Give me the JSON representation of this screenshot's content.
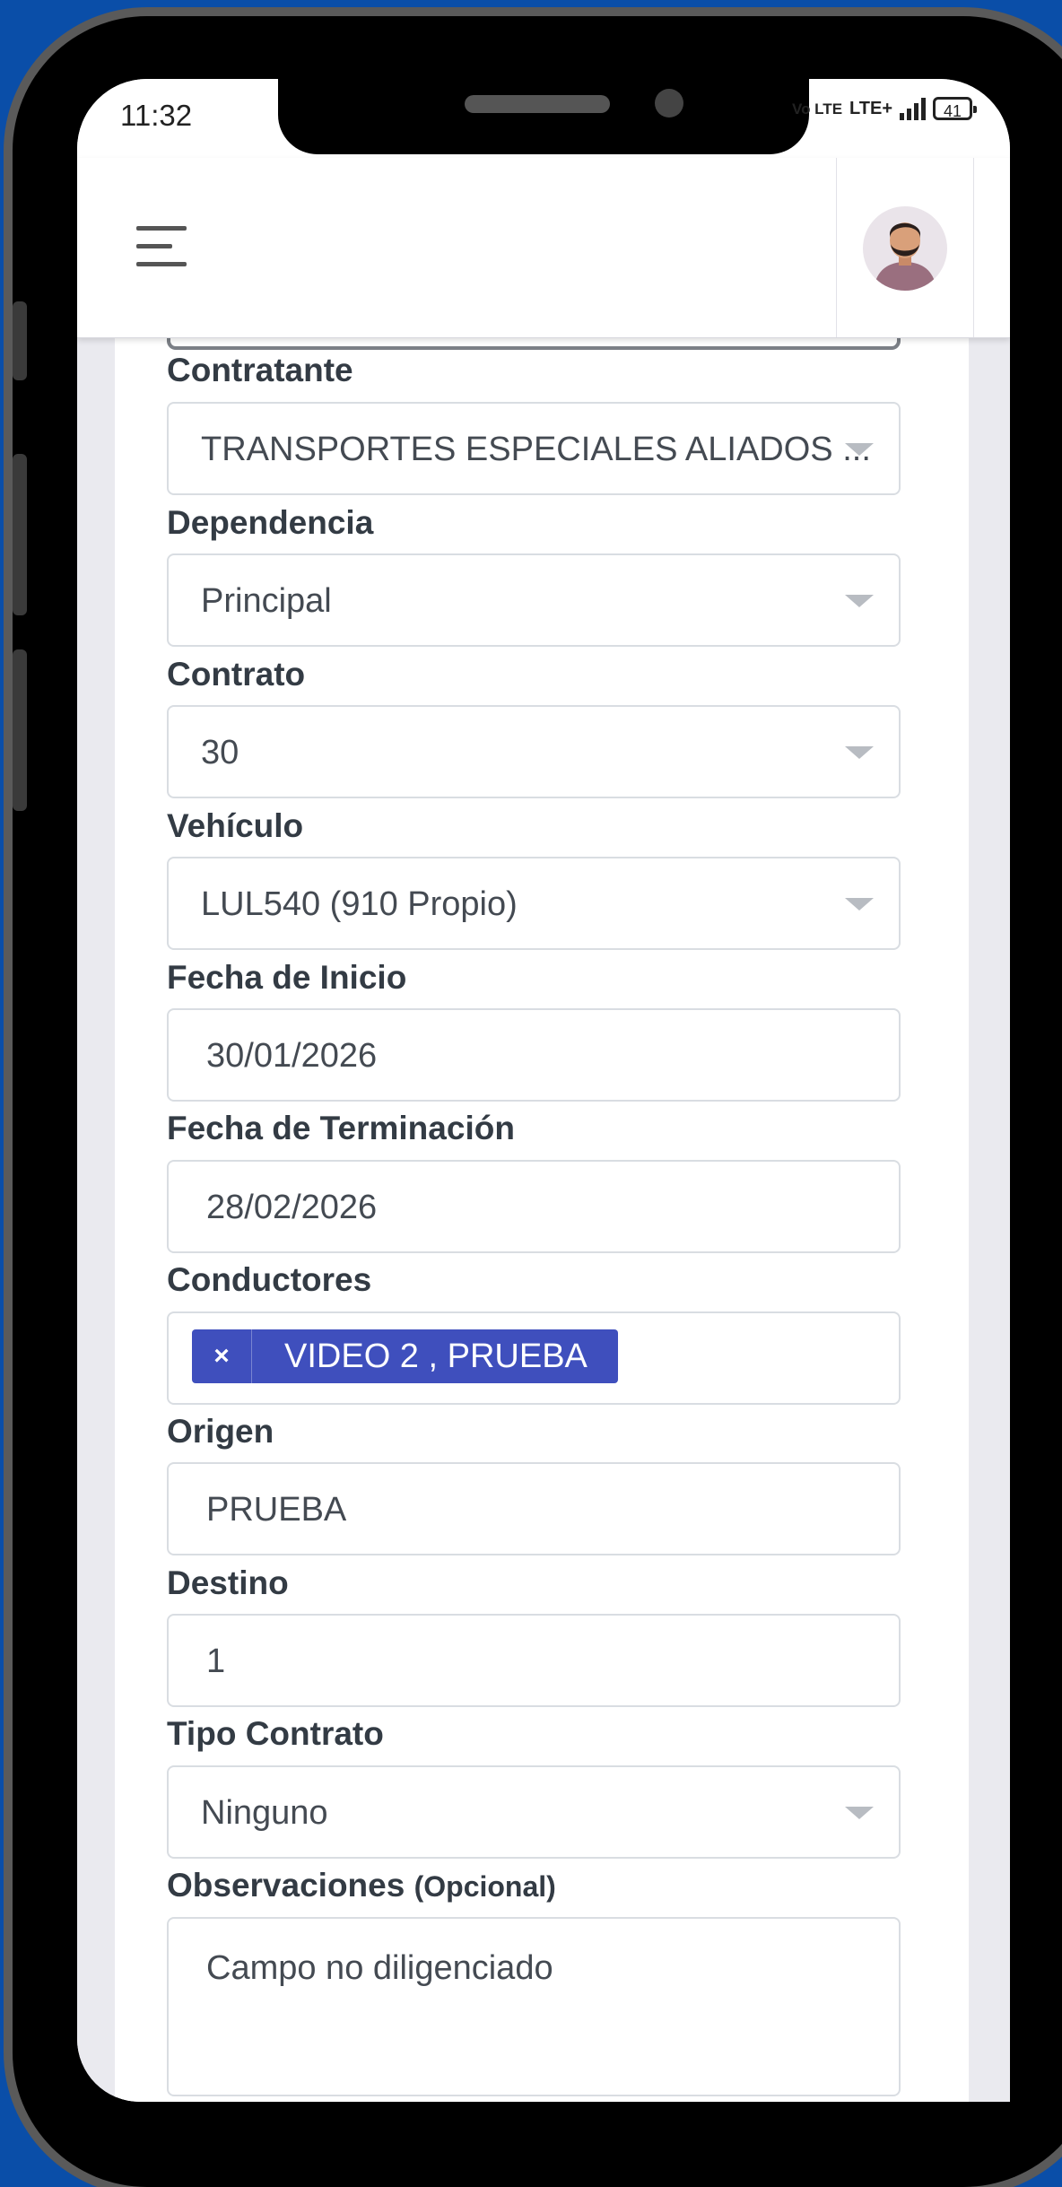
{
  "status_bar": {
    "time": "11:32",
    "network": "Vo LTE",
    "lte": "LTE+",
    "battery": "41"
  },
  "header": {
    "menu_icon": "hamburger-menu-icon",
    "avatar_icon": "user-avatar-icon"
  },
  "form": {
    "contratante": {
      "label": "Contratante",
      "value": "TRANSPORTES ESPECIALES ALIADOS ..."
    },
    "dependencia": {
      "label": "Dependencia",
      "value": "Principal"
    },
    "contrato": {
      "label": "Contrato",
      "value": "30"
    },
    "vehiculo": {
      "label": "Vehículo",
      "value": "LUL540 (910 Propio)"
    },
    "fecha_inicio": {
      "label": "Fecha de Inicio",
      "value": "30/01/2026"
    },
    "fecha_terminacion": {
      "label": "Fecha de Terminación",
      "value": "28/02/2026"
    },
    "conductores": {
      "label": "Conductores",
      "tag_remove": "×",
      "tag": "VIDEO 2 , PRUEBA"
    },
    "origen": {
      "label": "Origen",
      "value": "PRUEBA"
    },
    "destino": {
      "label": "Destino",
      "value": "1"
    },
    "tipo_contrato": {
      "label": "Tipo Contrato",
      "value": "Ninguno"
    },
    "observaciones": {
      "label": "Observaciones",
      "optional": "(Opcional)",
      "value": "Campo no diligenciado"
    }
  },
  "colors": {
    "tag_bg": "#3f4fbd",
    "page_bg": "#0a4ea8"
  }
}
